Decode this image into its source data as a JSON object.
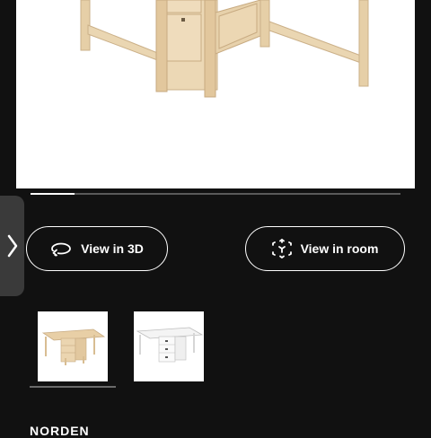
{
  "gallery": {
    "progress_fraction": 0.12
  },
  "actions": {
    "view_3d_label": "View in 3D",
    "view_room_label": "View in room"
  },
  "icons": {
    "side_tab": "chevron-right-icon",
    "view_3d": "rotate-3d-icon",
    "view_room": "ar-scan-icon"
  },
  "thumbnails": [
    {
      "variant": "birch"
    },
    {
      "variant": "white"
    }
  ],
  "product": {
    "name_partial": "NORDEN"
  },
  "colors": {
    "background": "#111111",
    "birch_wood": "#e8cfa6",
    "white_finish": "#f4f4f4"
  }
}
